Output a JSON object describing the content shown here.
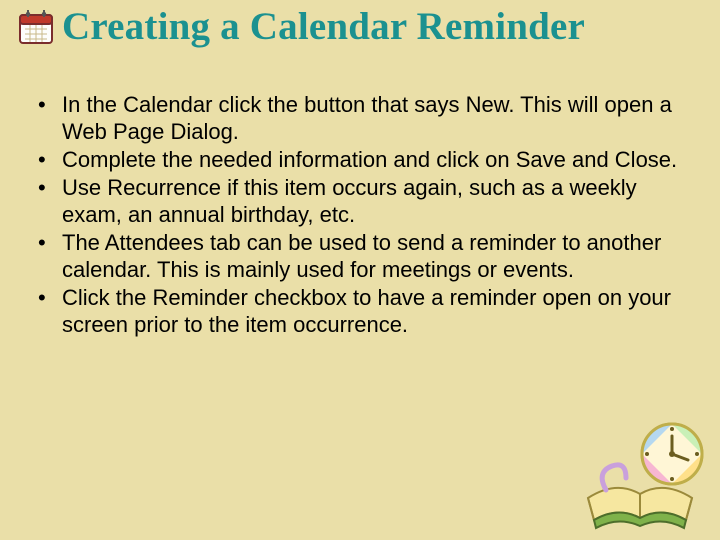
{
  "title": "Creating a Calendar Reminder",
  "bullets": [
    "In the Calendar click the button that says New.  This will open a Web Page Dialog.",
    "Complete the needed information and click on Save and Close.",
    "Use Recurrence if this item occurs again, such as a weekly exam, an annual birthday, etc.",
    "The Attendees tab can be used to send a reminder to another calendar.  This is mainly used for meetings or events.",
    "Click the Reminder checkbox to have a reminder open on your screen prior to the item occurrence."
  ]
}
